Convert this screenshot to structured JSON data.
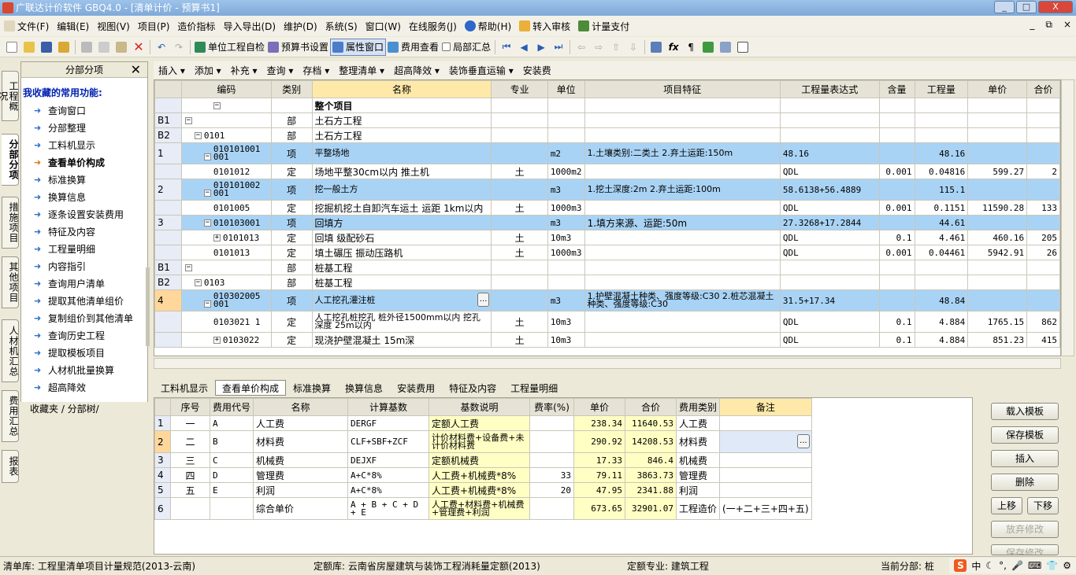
{
  "window": {
    "title": "广联达计价软件 GBQ4.0 - [清单计价 - 预算书1]",
    "buttons": [
      "_",
      "□",
      "X"
    ]
  },
  "menu": [
    "文件(F)",
    "编辑(E)",
    "视图(V)",
    "项目(P)",
    "造价指标",
    "导入导出(D)",
    "维护(D)",
    "系统(S)",
    "窗口(W)",
    "在线服务(J)",
    "帮助(H)",
    "转入审核",
    "计量支付"
  ],
  "mdi_buttons": [
    "_",
    "⧉",
    "×"
  ],
  "toolbar1": {
    "check": "单位工程自检",
    "settings": "预算书设置",
    "props": "属性窗口",
    "fee_view": "费用查看",
    "local_sum": "局部汇总"
  },
  "sidetabs": [
    "工程概况",
    "分部分项",
    "措施项目",
    "其他项目",
    "人材机汇总",
    "费用汇总",
    "报表"
  ],
  "leftpanel": {
    "title": "分部分项",
    "close": "✕",
    "fav_title": "我收藏的常用功能:",
    "items": [
      "查询窗口",
      "分部整理",
      "工料机显示",
      "查看单价构成",
      "标准换算",
      "换算信息",
      "逐条设置安装费用",
      "特征及内容",
      "工程量明细",
      "内容指引",
      "查询用户清单",
      "提取其他清单组价",
      "复制组价到其他清单",
      "查询历史工程",
      "提取模板项目",
      "人材机批量换算",
      "超高降效"
    ],
    "tabs": "收藏夹 / 分部树/"
  },
  "toolbar2": [
    "插入 ▾",
    "添加 ▾",
    "补充 ▾",
    "查询 ▾",
    "存档 ▾",
    "整理清单 ▾",
    "超高降效 ▾",
    "装饰垂直运输 ▾",
    "安装费"
  ],
  "grid": {
    "headers": [
      "",
      "编码",
      "类别",
      "名称",
      "专业",
      "单位",
      "项目特征",
      "工程量表达式",
      "含量",
      "工程量",
      "单价",
      "合价"
    ],
    "rows": [
      {
        "idx": "",
        "code": "",
        "type": "",
        "name": "整个项目",
        "major": "",
        "unit": "",
        "feat": "",
        "expr": "",
        "content": "",
        "qty": "",
        "price": "",
        "total": ""
      },
      {
        "idx": "B1",
        "code": "",
        "type": "部",
        "name": "土石方工程",
        "major": "",
        "unit": "",
        "feat": "",
        "expr": "",
        "content": "",
        "qty": "",
        "price": "",
        "total": ""
      },
      {
        "idx": "B2",
        "code": "0101",
        "type": "部",
        "name": "土石方工程",
        "major": "",
        "unit": "",
        "feat": "",
        "expr": "",
        "content": "",
        "qty": "",
        "price": "",
        "total": ""
      },
      {
        "idx": "1",
        "code": "010101001 001",
        "type": "项",
        "name": "平整场地",
        "major": "",
        "unit": "m2",
        "feat": "1.土壤类别:二类土 2.弃土运距:150m",
        "expr": "48.16",
        "content": "",
        "qty": "48.16",
        "price": "",
        "total": ""
      },
      {
        "idx": "",
        "code": "0101012",
        "type": "定",
        "name": "场地平整30cm以内 推土机",
        "major": "土",
        "unit": "1000m2",
        "feat": "",
        "expr": "QDL",
        "content": "0.001",
        "qty": "0.04816",
        "price": "599.27",
        "total": "2"
      },
      {
        "idx": "2",
        "code": "010101002 001",
        "type": "项",
        "name": "挖一般土方",
        "major": "",
        "unit": "m3",
        "feat": "1.挖土深度:2m 2.弃土运距:100m",
        "expr": "58.6138+56.4889",
        "content": "",
        "qty": "115.1",
        "price": "",
        "total": ""
      },
      {
        "idx": "",
        "code": "0101005",
        "type": "定",
        "name": "挖掘机挖土自卸汽车运土 运距 1km以内",
        "major": "土",
        "unit": "1000m3",
        "feat": "",
        "expr": "QDL",
        "content": "0.001",
        "qty": "0.1151",
        "price": "11590.28",
        "total": "133"
      },
      {
        "idx": "3",
        "code": "010103001",
        "type": "项",
        "name": "回填方",
        "major": "",
        "unit": "m3",
        "feat": "1.填方来源、运距:50m",
        "expr": "27.3268+17.2844",
        "content": "",
        "qty": "44.61",
        "price": "",
        "total": ""
      },
      {
        "idx": "",
        "code": "0101013",
        "type": "定",
        "name": "回填 级配砂石",
        "major": "土",
        "unit": "10m3",
        "feat": "",
        "expr": "QDL",
        "content": "0.1",
        "qty": "4.461",
        "price": "460.16",
        "total": "205"
      },
      {
        "idx": "",
        "code": "0101013",
        "type": "定",
        "name": "填土碾压 振动压路机",
        "major": "土",
        "unit": "1000m3",
        "feat": "",
        "expr": "QDL",
        "content": "0.001",
        "qty": "0.04461",
        "price": "5942.91",
        "total": "26"
      },
      {
        "idx": "B1",
        "code": "",
        "type": "部",
        "name": "桩基工程",
        "major": "",
        "unit": "",
        "feat": "",
        "expr": "",
        "content": "",
        "qty": "",
        "price": "",
        "total": ""
      },
      {
        "idx": "B2",
        "code": "0103",
        "type": "部",
        "name": "桩基工程",
        "major": "",
        "unit": "",
        "feat": "",
        "expr": "",
        "content": "",
        "qty": "",
        "price": "",
        "total": ""
      },
      {
        "idx": "4",
        "code": "010302005 001",
        "type": "项",
        "name": "人工挖孔灌注桩",
        "major": "",
        "unit": "m3",
        "feat": "1.护壁混凝土种类、强度等级:C30 2.桩芯混凝土种类、强度等级:C30",
        "expr": "31.5+17.34",
        "content": "",
        "qty": "48.84",
        "price": "",
        "total": ""
      },
      {
        "idx": "",
        "code": "0103021 1",
        "type": "定",
        "name": "人工挖孔桩挖孔 桩外径1500mm以内 挖孔深度 25m以内",
        "major": "土",
        "unit": "10m3",
        "feat": "",
        "expr": "QDL",
        "content": "0.1",
        "qty": "4.884",
        "price": "1765.15",
        "total": "862"
      },
      {
        "idx": "",
        "code": "0103022",
        "type": "定",
        "name": "现浇护壁混凝土 15m深",
        "major": "土",
        "unit": "10m3",
        "feat": "",
        "expr": "QDL",
        "content": "0.1",
        "qty": "4.884",
        "price": "851.23",
        "total": "415"
      }
    ]
  },
  "bottom_tabs": [
    "工料机显示",
    "查看单价构成",
    "标准换算",
    "换算信息",
    "安装费用",
    "特征及内容",
    "工程量明细"
  ],
  "bgrid": {
    "headers": [
      "",
      "序号",
      "费用代号",
      "名称",
      "计算基数",
      "基数说明",
      "费率(%)",
      "单价",
      "合价",
      "费用类别",
      "备注"
    ],
    "rows": [
      {
        "n": "1",
        "seq": "一",
        "code": "A",
        "name": "人工费",
        "base": "DERGF",
        "desc": "定额人工费",
        "rate": "",
        "price": "238.34",
        "total": "11640.53",
        "cat": "人工费",
        "note": ""
      },
      {
        "n": "2",
        "seq": "二",
        "code": "B",
        "name": "材料费",
        "base": "CLF+SBF+ZCF",
        "desc": "计价材料费+设备费+未计价材料费",
        "rate": "",
        "price": "290.92",
        "total": "14208.53",
        "cat": "材料费",
        "note": ""
      },
      {
        "n": "3",
        "seq": "三",
        "code": "C",
        "name": "机械费",
        "base": "DEJXF",
        "desc": "定额机械费",
        "rate": "",
        "price": "17.33",
        "total": "846.4",
        "cat": "机械费",
        "note": ""
      },
      {
        "n": "4",
        "seq": "四",
        "code": "D",
        "name": "管理费",
        "base": "A+C*8%",
        "desc": "人工费+机械费*8%",
        "rate": "33",
        "price": "79.11",
        "total": "3863.73",
        "cat": "管理费",
        "note": ""
      },
      {
        "n": "5",
        "seq": "五",
        "code": "E",
        "name": "利润",
        "base": "A+C*8%",
        "desc": "人工费+机械费*8%",
        "rate": "20",
        "price": "47.95",
        "total": "2341.88",
        "cat": "利润",
        "note": ""
      },
      {
        "n": "6",
        "seq": "",
        "code": "",
        "name": "综合单价",
        "base": "A + B + C + D + E",
        "desc": "人工费+材料费+机械费+管理费+利润",
        "rate": "",
        "price": "673.65",
        "total": "32901.07",
        "cat": "工程造价",
        "note": "(一+二+三+四+五)"
      }
    ]
  },
  "right_buttons": {
    "load": "载入模板",
    "save": "保存模板",
    "insert": "插入",
    "delete": "删除",
    "up": "上移",
    "down": "下移",
    "discard": "放弃修改",
    "keep": "保存修改"
  },
  "status": {
    "list": "清单库: 工程里清单项目计量规范(2013-云南)",
    "quota": "定额库: 云南省房屋建筑与装饰工程消耗量定额(2013)",
    "major": "定额专业: 建筑工程",
    "current": "当前分部: 桩"
  },
  "ime": {
    "logo": "S",
    "lang": "中"
  }
}
